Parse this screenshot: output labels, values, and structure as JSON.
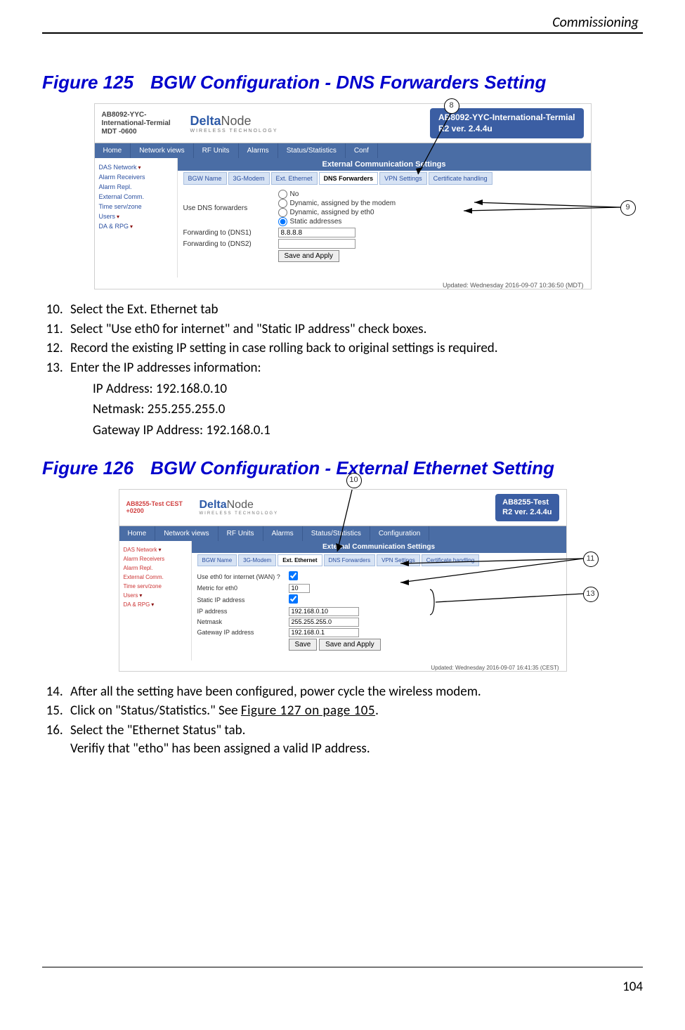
{
  "running_head": "Commissioning",
  "page_number": "104",
  "fig125": {
    "label": "Figure 125",
    "title": "BGW Configuration - DNS Forwarders Setting"
  },
  "fig126": {
    "label": "Figure 126",
    "title": "BGW Configuration - External Ethernet Setting"
  },
  "steps_a": {
    "start": 10,
    "items": [
      "Select the Ext. Ethernet tab",
      "Select \"Use eth0 for internet\" and \"Static IP address\" check boxes.",
      "Record the existing IP setting in case rolling back to original settings is required.",
      "Enter the IP addresses information:"
    ],
    "sub": [
      "IP Address: 192.168.0.10",
      "Netmask: 255.255.255.0",
      "Gateway IP Address: 192.168.0.1"
    ]
  },
  "steps_b": {
    "start": 14,
    "items": [
      "After all the setting have been configured, power cycle the wireless modem.",
      {
        "pre": "Click on \"Status/Statistics.\" See ",
        "xref": "Figure 127 on page 105",
        "post": "."
      },
      {
        "line1": "Select the \"Ethernet Status\" tab.",
        "line2": "Verifiy that \"etho\" has been assigned a valid IP address."
      }
    ]
  },
  "shot1": {
    "site_name": "AB8092-YYC-International-Termial MDT -0600",
    "brand": "DeltaNode",
    "brand_sub": "Wireless Technology",
    "badge_l1": "AB8092-YYC-International-Termial",
    "badge_l2": "R2 ver. 2.4.4u",
    "nav": [
      "Home",
      "Network views",
      "RF Units",
      "Alarms",
      "Status/Statistics",
      "Conf"
    ],
    "side": [
      "DAS Network",
      "Alarm Receivers",
      "Alarm Repl.",
      "External Comm.",
      "Time serv/zone",
      "Users",
      "DA & RPG"
    ],
    "side_carets": [
      true,
      false,
      false,
      false,
      false,
      true,
      true
    ],
    "section": "External Communication Settings",
    "tabs": [
      "BGW Name",
      "3G-Modem",
      "Ext. Ethernet",
      "DNS Forwarders",
      "VPN Settings",
      "Certificate handling"
    ],
    "active_tab": 3,
    "use_label": "Use DNS forwarders",
    "radios": [
      "No",
      "Dynamic, assigned by the modem",
      "Dynamic, assigned by eth0",
      "Static addresses"
    ],
    "radio_checked": 3,
    "fwd1_lbl": "Forwarding to (DNS1)",
    "fwd1_val": "8.8.8.8",
    "fwd2_lbl": "Forwarding to (DNS2)",
    "fwd2_val": "",
    "save_btn": "Save and Apply",
    "updated": "Updated: Wednesday 2016-09-07 10:36:50 (MDT)"
  },
  "shot2": {
    "site_name": "AB8255-Test CEST +0200",
    "brand": "DeltaNode",
    "brand_sub": "Wireless Technology",
    "badge_l1": "AB8255-Test",
    "badge_l2": "R2 ver. 2.4.4u",
    "nav": [
      "Home",
      "Network views",
      "RF Units",
      "Alarms",
      "Status/Statistics",
      "Configuration"
    ],
    "side": [
      "DAS Network",
      "Alarm Receivers",
      "Alarm Repl.",
      "External Comm.",
      "Time serv/zone",
      "Users",
      "DA & RPG"
    ],
    "side_carets": [
      true,
      false,
      false,
      false,
      false,
      true,
      true
    ],
    "section": "External Communication Settings",
    "tabs": [
      "BGW Name",
      "3G-Modem",
      "Ext. Ethernet",
      "DNS Forwarders",
      "VPN Settings",
      "Certificate handling"
    ],
    "active_tab": 2,
    "rows": {
      "use_lbl": "Use eth0 for internet (WAN) ?",
      "metric_lbl": "Metric for eth0",
      "metric_val": "10",
      "static_lbl": "Static IP address",
      "ip_lbl": "IP address",
      "ip_val": "192.168.0.10",
      "nm_lbl": "Netmask",
      "nm_val": "255.255.255.0",
      "gw_lbl": "Gateway IP address",
      "gw_val": "192.168.0.1"
    },
    "save_btn": "Save",
    "save_apply_btn": "Save and Apply",
    "updated": "Updated: Wednesday 2016-09-07 16:41:35 (CEST)"
  },
  "callouts": {
    "c8": "8",
    "c9": "9",
    "c10": "10",
    "c11": "11",
    "c13": "13"
  }
}
